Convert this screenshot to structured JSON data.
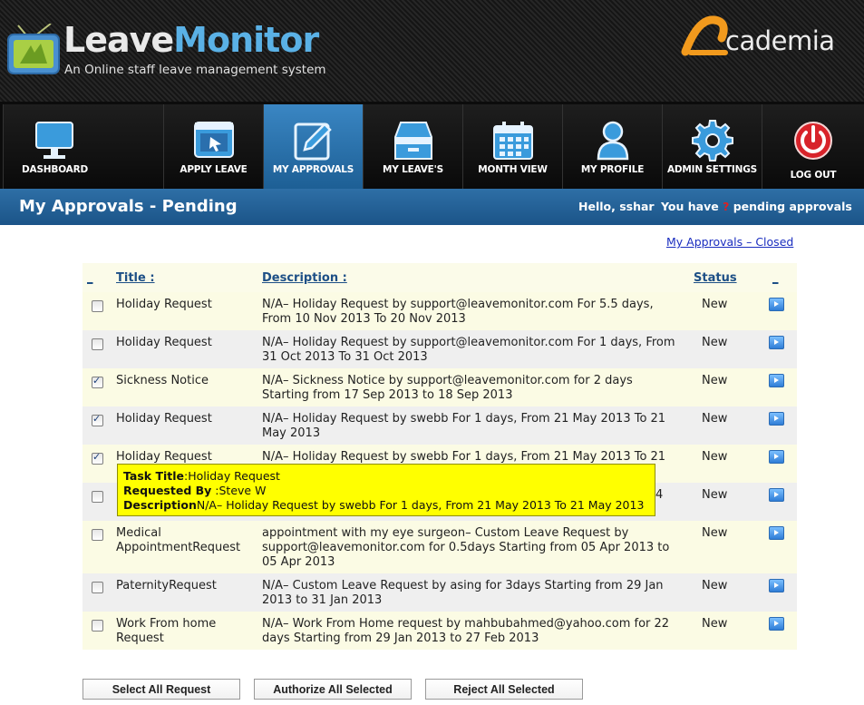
{
  "brand": {
    "leave": "Leave",
    "monitor": "Monitor",
    "tagline": "An Online staff leave management system",
    "partner": "cademia"
  },
  "nav": [
    {
      "label": "DASHBOARD",
      "icon": "monitor-icon",
      "active": false
    },
    {
      "label": "APPLY LEAVE",
      "icon": "window-cursor-icon",
      "active": false
    },
    {
      "label": "MY APPROVALS",
      "icon": "edit-pencil-icon",
      "active": true
    },
    {
      "label": "MY LEAVE'S",
      "icon": "inbox-drawer-icon",
      "active": false
    },
    {
      "label": "MONTH VIEW",
      "icon": "calendar-icon",
      "active": false
    },
    {
      "label": "MY PROFILE",
      "icon": "user-icon",
      "active": false
    },
    {
      "label": "ADMIN SETTINGS",
      "icon": "gear-icon",
      "active": false
    },
    {
      "label": "LOG OUT",
      "icon": "power-icon",
      "active": false
    }
  ],
  "titlebar": {
    "title": "My Approvals - Pending",
    "hello": "Hello, sshar",
    "pending_prefix": "You have",
    "pending_count": "?",
    "pending_suffix": "pending approvals"
  },
  "closed_link": "My Approvals – Closed",
  "table": {
    "headers": {
      "select": "_",
      "title": "Title :",
      "description": "Description :",
      "status": "Status",
      "action": "_"
    },
    "rows": [
      {
        "checked": false,
        "title": "Holiday Request",
        "description": "N/A– Holiday Request by support@leavemonitor.com For 5.5 days, From 10 Nov 2013 To 20 Nov 2013",
        "status": "New"
      },
      {
        "checked": false,
        "title": "Holiday Request",
        "description": "N/A– Holiday Request by support@leavemonitor.com For 1 days, From 31 Oct 2013 To 31 Oct 2013",
        "status": "New"
      },
      {
        "checked": true,
        "title": "Sickness Notice",
        "description": "N/A– Sickness Notice by support@leavemonitor.com for 2 days Starting from 17 Sep 2013 to 18 Sep 2013",
        "status": "New"
      },
      {
        "checked": true,
        "title": "Holiday Request",
        "description": "N/A– Holiday Request by swebb For 1 days, From 21 May 2013 To 21 May 2013",
        "status": "New"
      },
      {
        "checked": true,
        "title": "Holiday Request",
        "description": "N/A– Holiday Request by swebb For 1 days, From 21 May 2013 To 21",
        "status": "New"
      },
      {
        "checked": false,
        "title": "",
        "description": "4",
        "status": "New"
      },
      {
        "checked": false,
        "title": "Medical AppointmentRequest",
        "description": "appointment with my eye surgeon– Custom Leave Request by support@leavemonitor.com for 0.5days Starting from 05 Apr 2013 to 05 Apr 2013",
        "status": "New"
      },
      {
        "checked": false,
        "title": "PaternityRequest",
        "description": "N/A– Custom Leave Request by asing for 3days Starting from 29 Jan 2013 to 31 Jan 2013",
        "status": "New"
      },
      {
        "checked": false,
        "title": "Work From home Request",
        "description": "N/A– Work From Home request by mahbubahmed@yahoo.com for 22 days Starting from 29 Jan 2013 to 27 Feb 2013",
        "status": "New"
      }
    ]
  },
  "tooltip": {
    "task_title_label": "Task Title",
    "task_title": ":Holiday Request",
    "requested_by_label": "Requested By",
    "requested_by": " :Steve W",
    "description_label": "Description",
    "description": "N/A– Holiday Request by swebb For 1 days, From 21 May 2013 To 21 May 2013"
  },
  "buttons": {
    "select_all": "Select All Request",
    "authorize": "Authorize All Selected",
    "reject": "Reject All Selected"
  }
}
